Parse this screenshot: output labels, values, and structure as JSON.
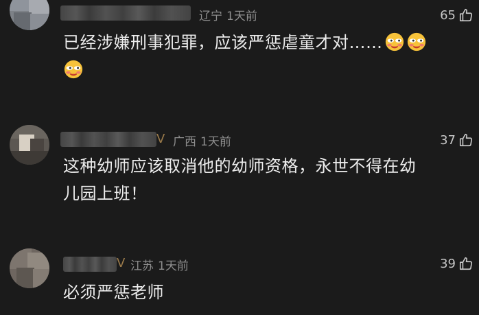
{
  "comments": [
    {
      "location": "辽宁",
      "time": "1天前",
      "likes": "65",
      "text": "已经涉嫌刑事犯罪，应该严惩虐童才对……"
    },
    {
      "location": "广西",
      "time": "1天前",
      "likes": "37",
      "text": "这种幼师应该取消他的幼师资格，永世不得在幼儿园上班！"
    },
    {
      "location": "江苏",
      "time": "1天前",
      "likes": "39",
      "text": "必须严惩老师"
    }
  ],
  "icons": {
    "like": "thumbs-up-icon",
    "emoji": "smirk-face-emoji",
    "verified": "v-badge-icon"
  },
  "colors": {
    "background": "#1b1b1b",
    "meta_text": "#8e8e8e",
    "body_text": "#ececec"
  }
}
